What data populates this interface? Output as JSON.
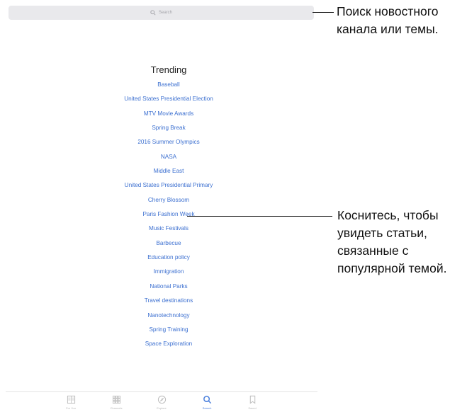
{
  "search": {
    "placeholder": "Search"
  },
  "trending": {
    "title": "Trending",
    "items": [
      "Baseball",
      "United States Presidential Election",
      "MTV Movie Awards",
      "Spring Break",
      "2016 Summer Olympics",
      "NASA",
      "Middle East",
      "United States Presidential Primary",
      "Cherry Blossom",
      "Paris Fashion Week",
      "Music Festivals",
      "Barbecue",
      "Education policy",
      "Immigration",
      "National Parks",
      "Travel destinations",
      "Nanotechnology",
      "Spring Training",
      "Space Exploration"
    ]
  },
  "tab_bar": {
    "tabs": [
      {
        "label": "For You",
        "icon": "for-you-icon",
        "active": false
      },
      {
        "label": "Channels",
        "icon": "channels-icon",
        "active": false
      },
      {
        "label": "Explore",
        "icon": "compass-icon",
        "active": false
      },
      {
        "label": "Search",
        "icon": "search-icon",
        "active": true
      },
      {
        "label": "Saved",
        "icon": "bookmark-icon",
        "active": false
      }
    ]
  },
  "callouts": {
    "search_note_line1": "Поиск новостного",
    "search_note_line2": "канала или темы.",
    "topic_note_line1": "Коснитесь, чтобы",
    "topic_note_line2": "увидеть статьи,",
    "topic_note_line3": "связанные с",
    "topic_note_line4": "популярной темой."
  },
  "colors": {
    "link": "#3b6fd0",
    "active_tab": "#4a7fdc",
    "inactive_tab": "#b9b9b9",
    "search_bg": "#e9e9ec"
  }
}
